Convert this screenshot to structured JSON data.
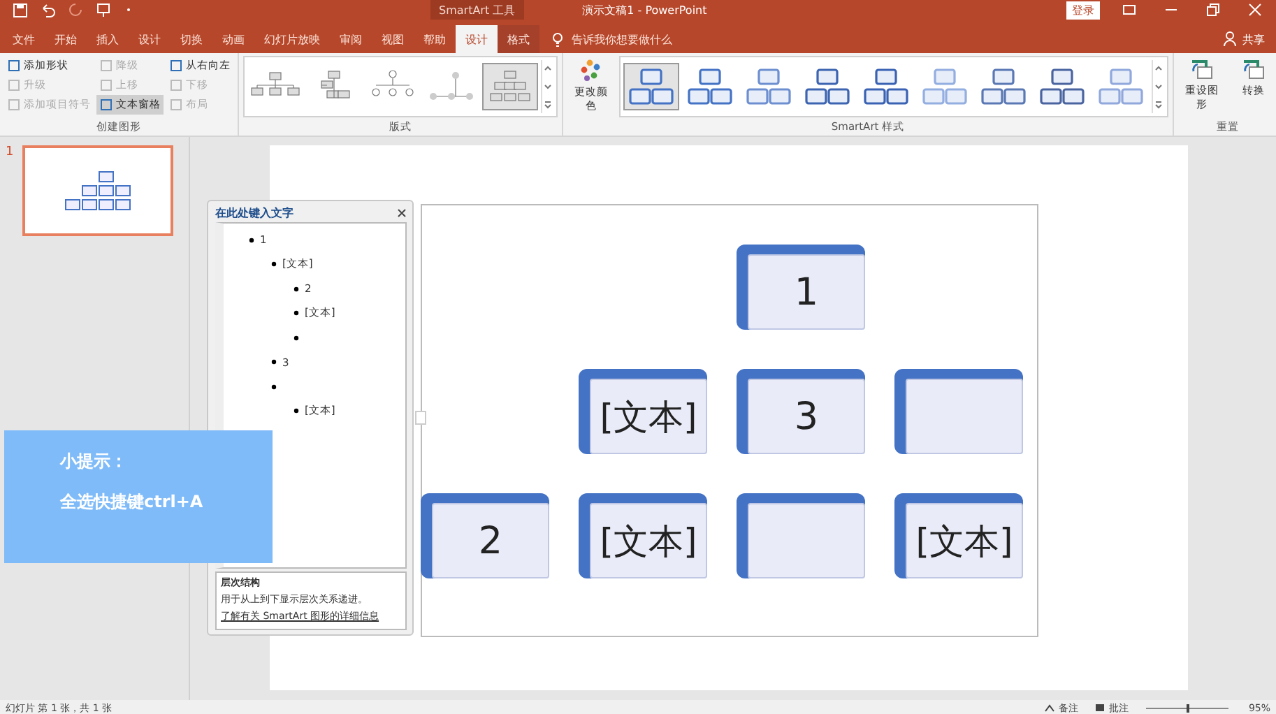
{
  "title_bar": {
    "contextual_label": "SmartArt 工具",
    "title": "演示文稿1 - PowerPoint",
    "login": "登录"
  },
  "tabs": [
    {
      "label": "文件",
      "selected": false,
      "kind": "file"
    },
    {
      "label": "开始",
      "selected": false,
      "kind": "normal"
    },
    {
      "label": "插入",
      "selected": false,
      "kind": "normal"
    },
    {
      "label": "设计",
      "selected": false,
      "kind": "normal"
    },
    {
      "label": "切换",
      "selected": false,
      "kind": "normal"
    },
    {
      "label": "动画",
      "selected": false,
      "kind": "normal"
    },
    {
      "label": "幻灯片放映",
      "selected": false,
      "kind": "normal"
    },
    {
      "label": "审阅",
      "selected": false,
      "kind": "normal"
    },
    {
      "label": "视图",
      "selected": false,
      "kind": "normal"
    },
    {
      "label": "帮助",
      "selected": false,
      "kind": "normal"
    },
    {
      "label": "设计",
      "selected": true,
      "kind": "contextual"
    },
    {
      "label": "格式",
      "selected": false,
      "kind": "contextual"
    }
  ],
  "tell_me": "告诉我你想要做什么",
  "share": "共享",
  "ribbon": {
    "create_group": {
      "label": "创建图形",
      "commands": [
        {
          "label": "添加形状",
          "disabled": false,
          "selected": false
        },
        {
          "label": "升级",
          "disabled": true,
          "selected": false
        },
        {
          "label": "添加项目符号",
          "disabled": true,
          "selected": false
        },
        {
          "label": "降级",
          "disabled": true,
          "selected": false
        },
        {
          "label": "上移",
          "disabled": true,
          "selected": false
        },
        {
          "label": "文本窗格",
          "disabled": false,
          "selected": true
        },
        {
          "label": "从右向左",
          "disabled": false,
          "selected": false
        },
        {
          "label": "下移",
          "disabled": true,
          "selected": false
        },
        {
          "label": "布局",
          "disabled": true,
          "selected": false
        }
      ]
    },
    "layout_group": {
      "label": "版式",
      "layouts": [
        {
          "selected": false
        },
        {
          "selected": false
        },
        {
          "selected": false
        },
        {
          "selected": false
        },
        {
          "selected": true
        }
      ]
    },
    "style_group": {
      "label": "SmartArt 样式",
      "color_button": "更改颜色",
      "styles": [
        {
          "selected": true
        },
        {
          "selected": false
        },
        {
          "selected": false
        },
        {
          "selected": false
        },
        {
          "selected": false
        },
        {
          "selected": false
        },
        {
          "selected": false
        },
        {
          "selected": false
        },
        {
          "selected": false
        }
      ]
    },
    "reset_group": {
      "label": "重置",
      "buttons": [
        "重设图形",
        "转换"
      ]
    }
  },
  "slides": [
    {
      "number": "1",
      "selected": true
    }
  ],
  "text_pane": {
    "title": "在此处键入文字",
    "items": [
      {
        "kind": "bullet",
        "text": "1",
        "children": [
          {
            "kind": "bullet",
            "text": "[文本]",
            "children": [
              {
                "kind": "bullet",
                "text": "2"
              },
              {
                "kind": "bullet",
                "text": "[文本]"
              },
              {
                "kind": "bullet"
              }
            ]
          },
          {
            "kind": "bullet",
            "text": "3"
          },
          {
            "kind": "bullet",
            "children": [
              {
                "kind": "bullet",
                "text": "[文本]"
              }
            ]
          }
        ]
      }
    ],
    "footer_heading": "层次结构",
    "footer_description": "用于从上到下显示层次关系递进。",
    "footer_link": "了解有关 SmartArt 图形的详细信息"
  },
  "diagram": {
    "nodes": [
      {
        "kind": "shape",
        "text": "1",
        "children": [
          {
            "kind": "shape",
            "text": "[文本]",
            "children": [
              {
                "kind": "shape",
                "text": "2"
              },
              {
                "kind": "shape",
                "text": "[文本]"
              },
              {
                "kind": "shape"
              }
            ]
          },
          {
            "kind": "shape",
            "text": "3"
          },
          {
            "kind": "shape",
            "children": [
              {
                "kind": "shape",
                "text": "[文本]"
              }
            ]
          }
        ]
      }
    ]
  },
  "tip": {
    "title": "小提示：",
    "body": "全选快捷键ctrl+A"
  },
  "status_bar": {
    "slide_info": "幻灯片 第 1 张，共 1 张",
    "notes": "备注",
    "comments": "批注",
    "zoom": "95%"
  }
}
